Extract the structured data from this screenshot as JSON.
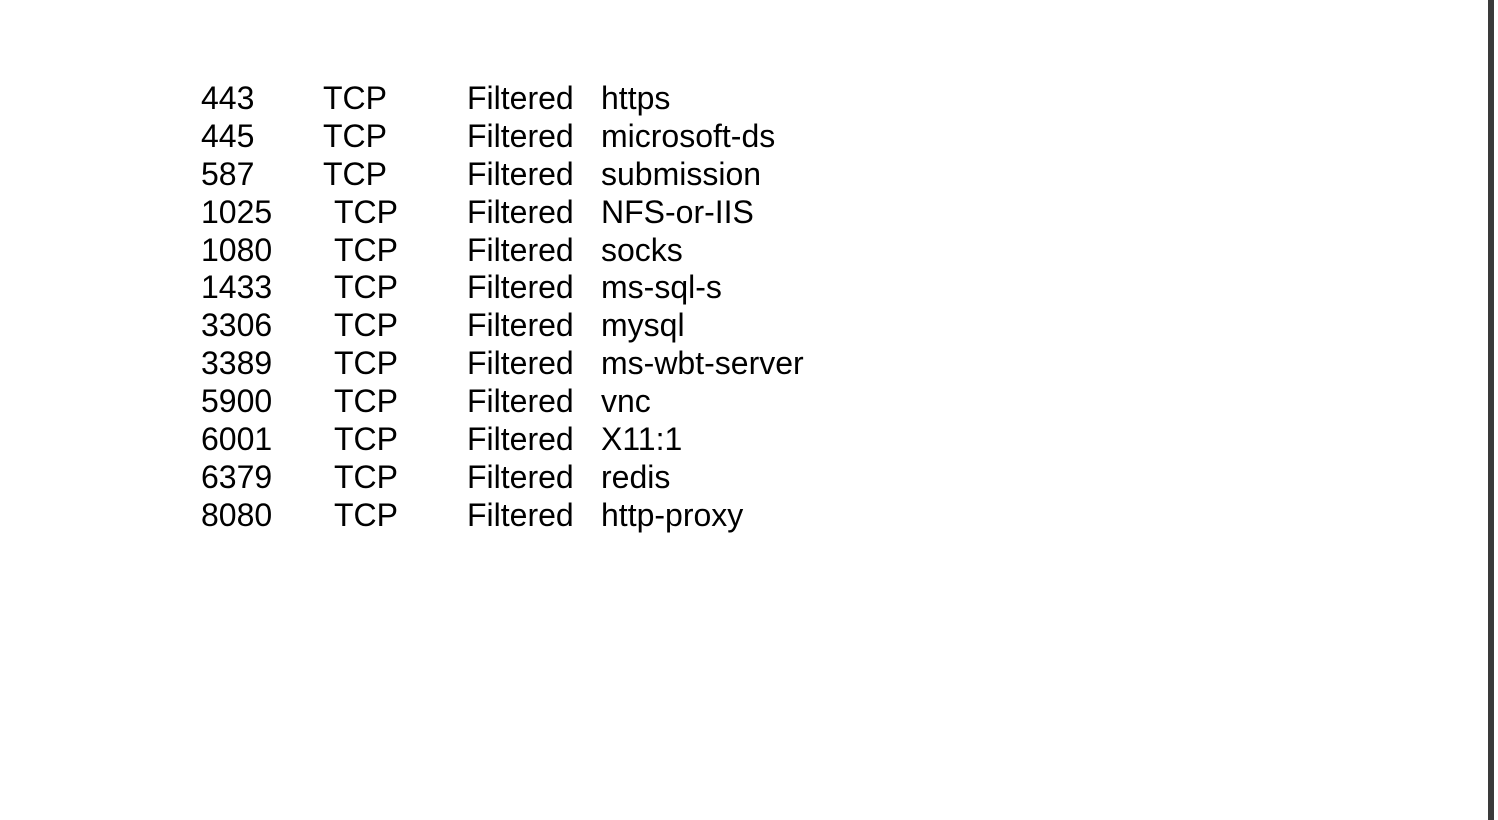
{
  "colors": {
    "background": "#ffffff",
    "text": "#000000",
    "edge_bar": "#3a3a3a"
  },
  "port_table": {
    "rows": [
      {
        "port": "443",
        "protocol": "TCP",
        "state": "Filtered",
        "service": "https"
      },
      {
        "port": "445",
        "protocol": "TCP",
        "state": "Filtered",
        "service": "microsoft-ds"
      },
      {
        "port": "587",
        "protocol": "TCP",
        "state": "Filtered",
        "service": "submission"
      },
      {
        "port": "1025",
        "protocol": "TCP",
        "state": "Filtered",
        "service": "NFS-or-IIS"
      },
      {
        "port": "1080",
        "protocol": "TCP",
        "state": "Filtered",
        "service": "socks"
      },
      {
        "port": "1433",
        "protocol": "TCP",
        "state": "Filtered",
        "service": "ms-sql-s"
      },
      {
        "port": "3306",
        "protocol": "TCP",
        "state": "Filtered",
        "service": "mysql"
      },
      {
        "port": "3389",
        "protocol": "TCP",
        "state": "Filtered",
        "service": "ms-wbt-server"
      },
      {
        "port": "5900",
        "protocol": "TCP",
        "state": "Filtered",
        "service": "vnc"
      },
      {
        "port": "6001",
        "protocol": "TCP",
        "state": "Filtered",
        "service": "X11:1"
      },
      {
        "port": "6379",
        "protocol": "TCP",
        "state": "Filtered",
        "service": "redis"
      },
      {
        "port": "8080",
        "protocol": "TCP",
        "state": "Filtered",
        "service": "http-proxy"
      }
    ]
  }
}
